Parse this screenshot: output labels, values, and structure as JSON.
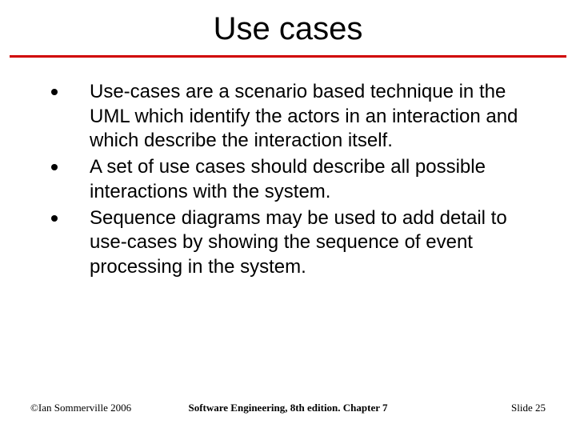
{
  "title": "Use cases",
  "bullets": [
    "Use-cases are a scenario based technique in the UML which identify the actors in an interaction and which describe the interaction itself.",
    "A set of use cases should describe all possible interactions with the system.",
    "Sequence diagrams may be used to add detail to use-cases by showing the sequence of event processing in the system."
  ],
  "footer": {
    "left": "©Ian Sommerville 2006",
    "center": "Software Engineering, 8th edition. Chapter 7",
    "right": "Slide 25"
  }
}
